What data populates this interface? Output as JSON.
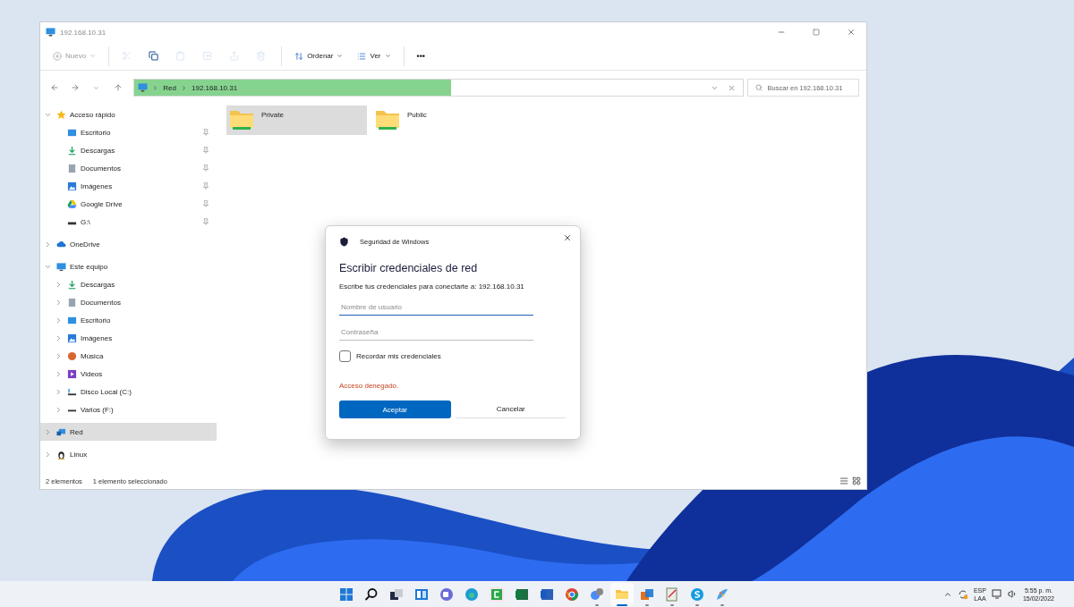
{
  "window": {
    "title": "192.168.10.31"
  },
  "toolbar": [
    {
      "kind": "menu",
      "label": "Nuevo",
      "disabled": true
    },
    {
      "kind": "separator"
    },
    {
      "kind": "icon",
      "disabled": true
    },
    {
      "kind": "icon",
      "disabled": false
    },
    {
      "kind": "icon",
      "disabled": true
    },
    {
      "kind": "icon",
      "disabled": true
    },
    {
      "kind": "icon",
      "disabled": true
    },
    {
      "kind": "icon",
      "disabled": true
    },
    {
      "kind": "separator"
    },
    {
      "kind": "menu",
      "label": "Ordenar",
      "disabled": false
    },
    {
      "kind": "menu",
      "label": "Ver",
      "disabled": false
    },
    {
      "kind": "separator"
    },
    {
      "kind": "more",
      "label": "•••",
      "disabled": false
    }
  ],
  "address": {
    "crumbs": [
      "Red",
      "192.168.10.31"
    ],
    "progress": {
      "level": 0.52
    },
    "search_placeholder": "Buscar en 192.168.10.31"
  },
  "sidebar": {
    "items": [
      {
        "label": "Acceso rápido",
        "expanded": true,
        "selected": false,
        "children": [
          {
            "label": "Escritorio",
            "pinned": true,
            "selected": false
          },
          {
            "label": "Descargas",
            "pinned": true,
            "selected": false
          },
          {
            "label": "Documentos",
            "pinned": true,
            "selected": false
          },
          {
            "label": "Imágenes",
            "pinned": true,
            "selected": false
          },
          {
            "label": "Google Drive",
            "pinned": true,
            "selected": false
          },
          {
            "label": "G:\\",
            "pinned": true,
            "selected": false
          }
        ]
      },
      {
        "label": "OneDrive",
        "expanded": false,
        "selected": false
      },
      {
        "label": "Este equipo",
        "expanded": true,
        "selected": false,
        "children": [
          {
            "label": "Descargas",
            "expanded": false,
            "selected": false
          },
          {
            "label": "Documentos",
            "expanded": false,
            "selected": false
          },
          {
            "label": "Escritorio",
            "expanded": false,
            "selected": false
          },
          {
            "label": "Imágenes",
            "expanded": false,
            "selected": false
          },
          {
            "label": "Música",
            "expanded": false,
            "selected": false
          },
          {
            "label": "Videos",
            "expanded": false,
            "selected": false
          },
          {
            "label": "Disco Local (C:)",
            "expanded": false,
            "selected": false
          },
          {
            "label": "Varios (F:)",
            "expanded": false,
            "selected": false
          }
        ]
      },
      {
        "label": "Red",
        "expanded": false,
        "selected": true
      },
      {
        "label": "Linux",
        "expanded": false,
        "selected": false
      }
    ]
  },
  "content": {
    "items": [
      {
        "label": "Private",
        "selected": true
      },
      {
        "label": "Public",
        "selected": false
      }
    ]
  },
  "status_bar": {
    "count": "2 elementos",
    "selection": "1 elemento seleccionado"
  },
  "dialog": {
    "app": "Seguridad de Windows",
    "title": "Escribir credenciales de red",
    "message": "Escribe tus credenciales para conectarte a: 192.168.10.31",
    "fields": [
      {
        "placeholder": "Nombre de usuario",
        "focused": true
      },
      {
        "placeholder": "Contraseña",
        "focused": false
      }
    ],
    "remember": {
      "label": "Recordar mis credenciales",
      "checked": false
    },
    "error": "Acceso denegado.",
    "buttons": [
      {
        "label": "Aceptar",
        "primary": true
      },
      {
        "label": "Cancelar",
        "primary": false
      }
    ]
  },
  "taskbar": {
    "apps": [
      {
        "running": false,
        "active": false
      },
      {
        "running": false,
        "active": false
      },
      {
        "running": false,
        "active": false
      },
      {
        "running": false,
        "active": false
      },
      {
        "running": false,
        "active": false
      },
      {
        "running": false,
        "active": false
      },
      {
        "running": false,
        "active": false
      },
      {
        "running": false,
        "active": false
      },
      {
        "running": false,
        "active": false
      },
      {
        "running": false,
        "active": false
      },
      {
        "running": true,
        "active": false
      },
      {
        "running": true,
        "active": true
      },
      {
        "running": true,
        "active": false
      },
      {
        "running": true,
        "active": false
      },
      {
        "running": true,
        "active": false
      },
      {
        "running": true,
        "active": false
      }
    ]
  },
  "tray": {
    "language": "ESP",
    "layout": "LAA",
    "time": "5:55 p. m.",
    "date": "15/02/2022"
  }
}
